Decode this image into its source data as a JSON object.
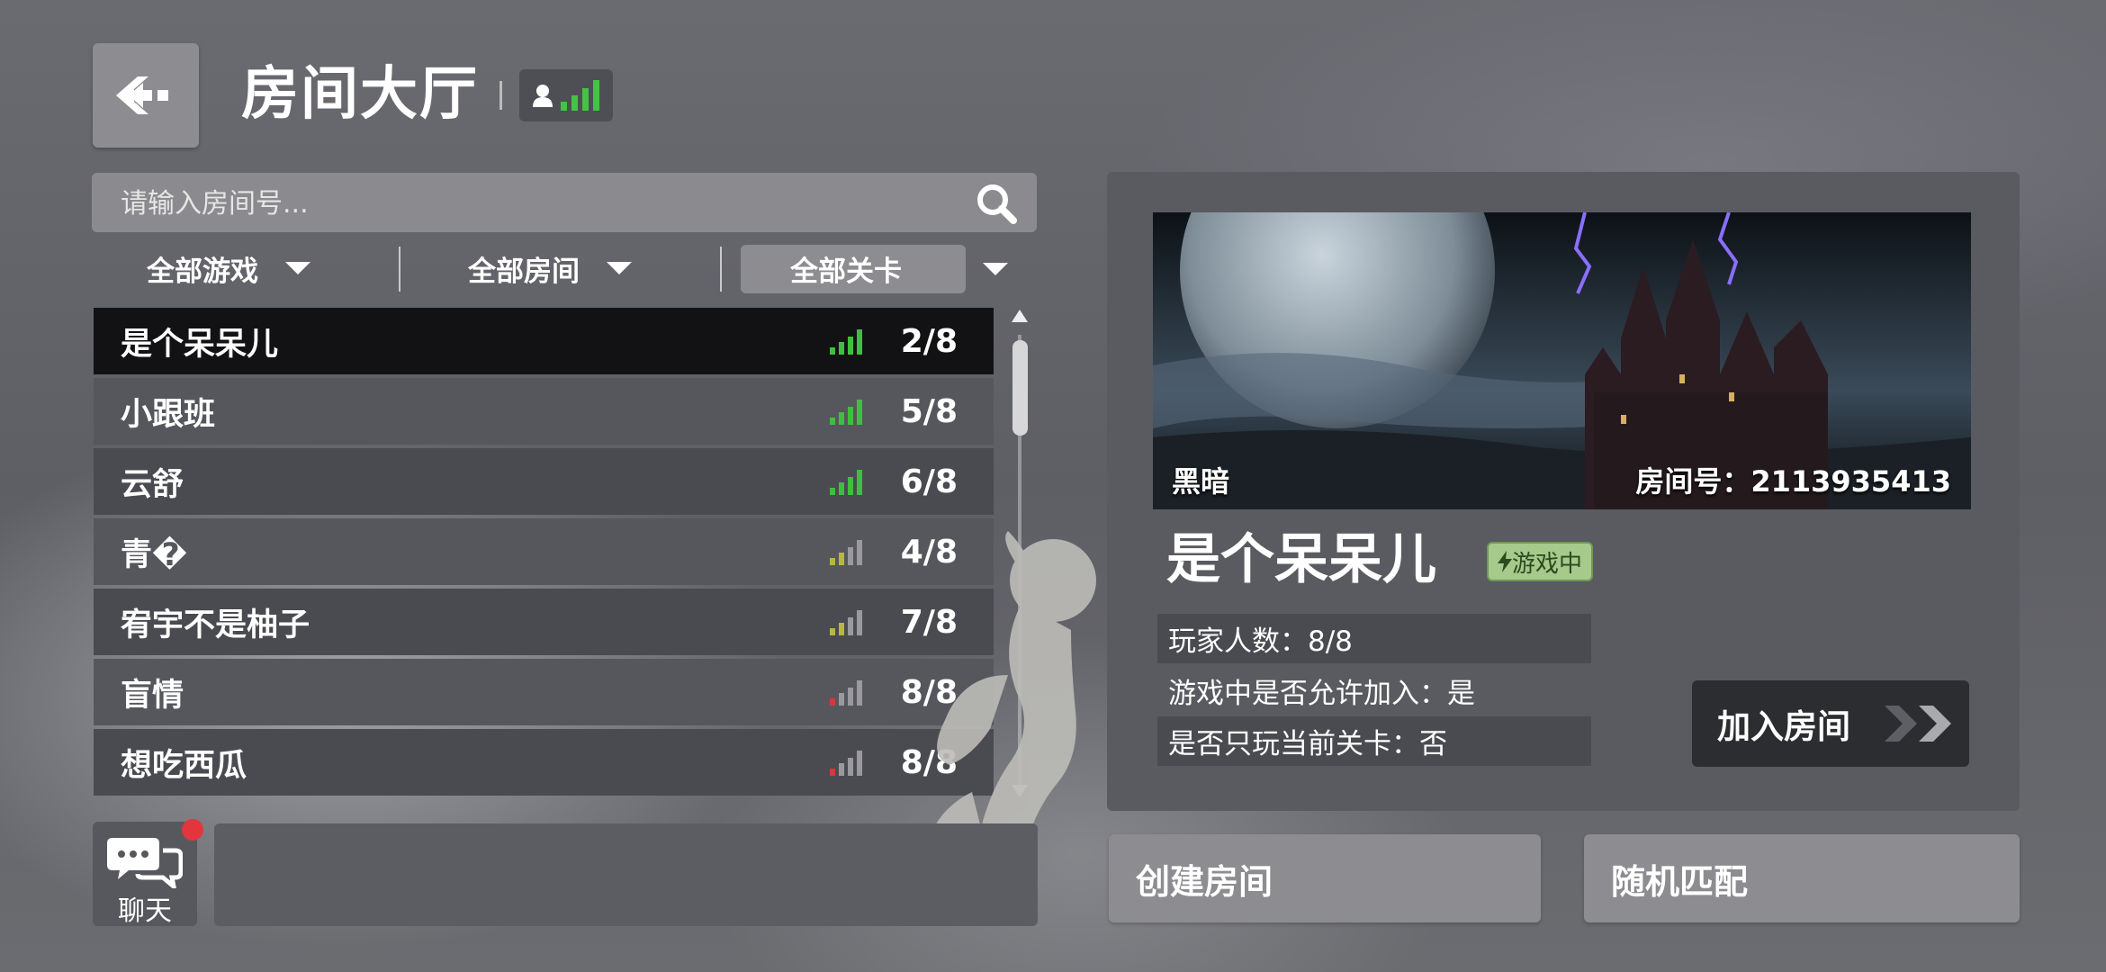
{
  "header": {
    "title": "房间大厅"
  },
  "search": {
    "placeholder": "请输入房间号..."
  },
  "filters": {
    "game": "全部游戏",
    "room": "全部房间",
    "level": "全部关卡"
  },
  "rooms": [
    {
      "name": "是个呆呆儿",
      "count": "2/8",
      "signal": 4,
      "signal_color": "#3fbf3f",
      "selected": true
    },
    {
      "name": "小跟班",
      "count": "5/8",
      "signal": 4,
      "signal_color": "#3fbf3f",
      "selected": false
    },
    {
      "name": "云舒",
      "count": "6/8",
      "signal": 4,
      "signal_color": "#3fbf3f",
      "selected": false
    },
    {
      "name": "青�",
      "count": "4/8",
      "signal": 2,
      "signal_color": "#b7b83e",
      "selected": false
    },
    {
      "name": "宥宇不是柚子",
      "count": "7/8",
      "signal": 2,
      "signal_color": "#b7b83e",
      "selected": false
    },
    {
      "name": "盲情",
      "count": "8/8",
      "signal": 1,
      "signal_color": "#d23a3a",
      "selected": false
    },
    {
      "name": "想吃西瓜",
      "count": "8/8",
      "signal": 1,
      "signal_color": "#d23a3a",
      "selected": false
    }
  ],
  "chat": {
    "label": "聊天"
  },
  "detail": {
    "level_name": "黑暗",
    "room_id": "房间号：2113935413",
    "room_name": "是个呆呆儿",
    "status": "游戏中",
    "players": "玩家人数：8/8",
    "allow_join": "游戏中是否允许加入：是",
    "current_only": "是否只玩当前关卡：否",
    "join_label": "加入房间"
  },
  "actions": {
    "create": "创建房间",
    "match": "随机匹配"
  },
  "colors": {
    "signal_good": "#3fbf3f",
    "signal_mid": "#b7b83e",
    "signal_bad": "#d23a3a",
    "status_bg": "#a6c98c"
  }
}
